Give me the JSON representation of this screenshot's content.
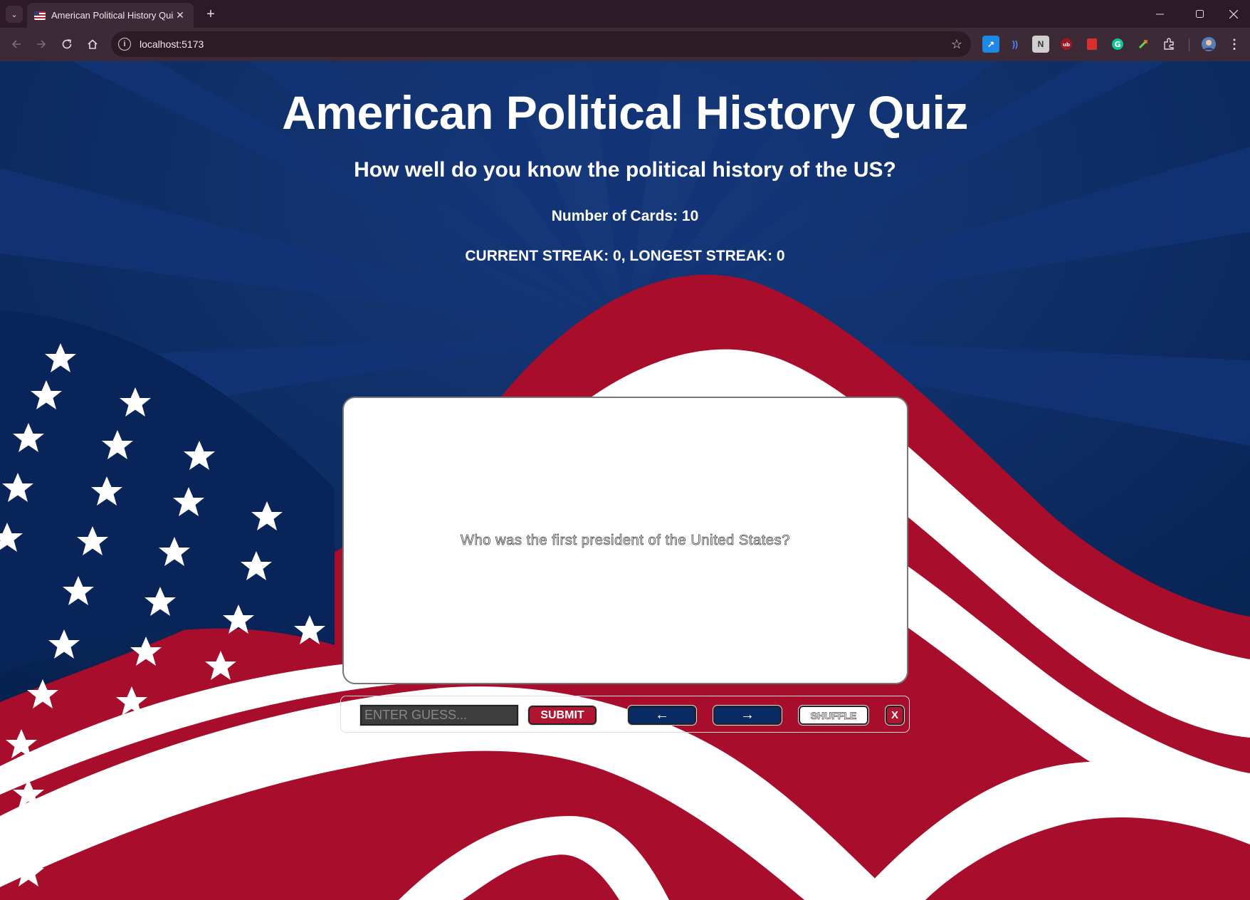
{
  "browser": {
    "tab_title": "American Political History Quiz",
    "tab_close": "✕",
    "new_tab": "+",
    "url": "localhost:5173",
    "menu_glyph": "⌄",
    "icons": [
      "back-icon",
      "forward-icon",
      "reload-icon",
      "home-icon",
      "site-info-icon",
      "bookmark-star-icon",
      "extensions-icon",
      "profile-avatar",
      "more-menu-icon"
    ],
    "window_controls": [
      "minimize",
      "maximize",
      "close"
    ]
  },
  "header": {
    "title": "American Political History Quiz",
    "subtitle": "How well do you know the political history of the US?",
    "card_count": "Number of Cards: 10",
    "streak": "CURRENT STREAK: 0, LONGEST STREAK: 0"
  },
  "card": {
    "question": "Who was the first president of the United States?"
  },
  "controls": {
    "guess_placeholder": "ENTER GUESS...",
    "submit_label": "SUBMIT",
    "prev_label": "←",
    "next_label": "→",
    "shuffle_label": "SHUFFLE",
    "close_label": "X"
  },
  "colors": {
    "navy": "#0a2a63",
    "red": "#b01632",
    "white": "#ffffff",
    "chrome_dark": "#2c1b27",
    "chrome_toolbar": "#3c2a36"
  }
}
